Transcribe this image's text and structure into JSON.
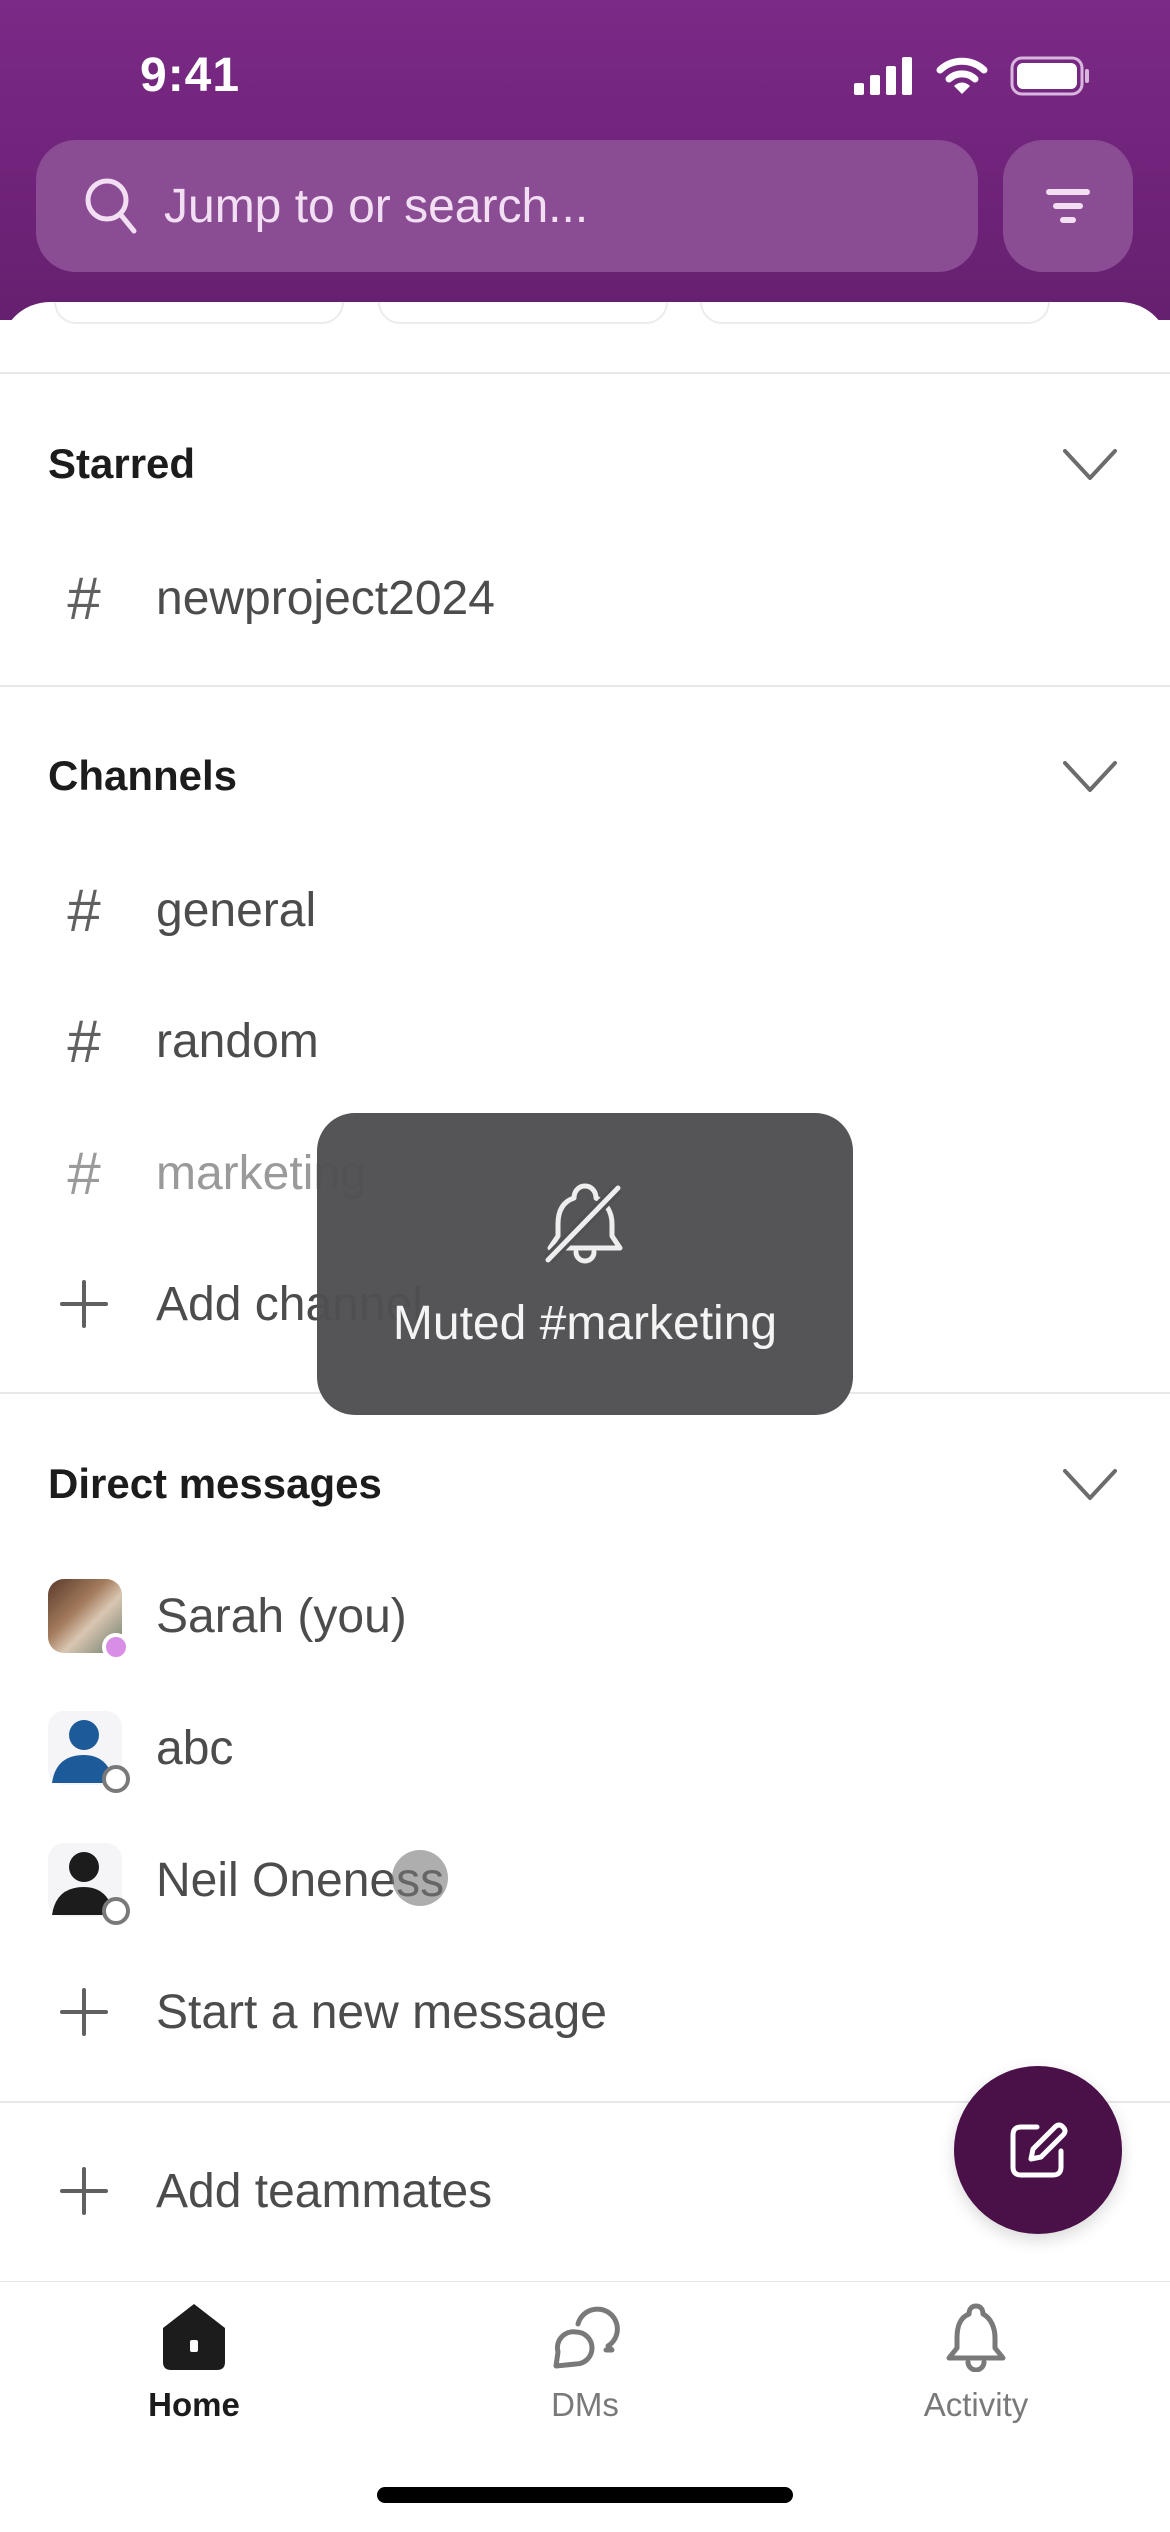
{
  "status_bar": {
    "time": "9:41"
  },
  "search": {
    "placeholder": "Jump to or search..."
  },
  "starred": {
    "title": "Starred",
    "items": [
      {
        "label": "newproject2024",
        "icon": "hash-icon"
      }
    ]
  },
  "channels": {
    "title": "Channels",
    "items": [
      {
        "label": "general",
        "icon": "hash-icon",
        "muted": false
      },
      {
        "label": "random",
        "icon": "hash-icon",
        "muted": false
      },
      {
        "label": "marketing",
        "icon": "hash-icon",
        "muted": true
      }
    ],
    "add_label": "Add channel"
  },
  "direct_messages": {
    "title": "Direct messages",
    "items": [
      {
        "label": "Sarah (you)",
        "presence": "active",
        "presence_color": "#d98ee6"
      },
      {
        "label": "abc",
        "presence": "away",
        "avatar_color": "#1d5a9a"
      },
      {
        "label": "Neil Oneness",
        "presence": "away",
        "avatar_color": "#1d1c1d"
      }
    ],
    "new_message_label": "Start a new message"
  },
  "add_teammates_label": "Add teammates",
  "toast": {
    "icon": "bell-off-icon",
    "text": "Muted #marketing"
  },
  "tabbar": {
    "items": [
      {
        "label": "Home",
        "icon": "home-icon",
        "active": true
      },
      {
        "label": "DMs",
        "icon": "dms-icon",
        "active": false
      },
      {
        "label": "Activity",
        "icon": "bell-icon",
        "active": false
      }
    ]
  },
  "colors": {
    "header": "#7b2a86",
    "fab": "#4a1048",
    "toast": "#504f53"
  }
}
